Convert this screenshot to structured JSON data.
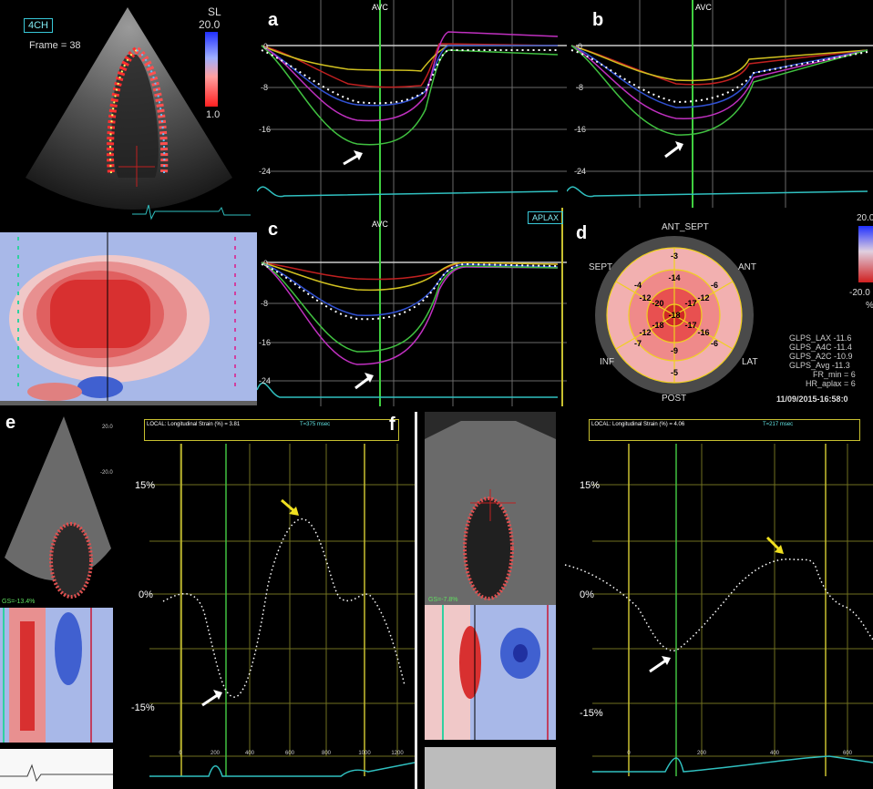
{
  "echo_top": {
    "view_box": "4CH",
    "frame_label": "Frame = 38",
    "scale_label": "SL",
    "scale_top": "20.0",
    "scale_bottom": "1.0"
  },
  "panel_a": {
    "letter": "a",
    "avc": "AVC",
    "ticks": [
      "0",
      "-8",
      "-16",
      "-24"
    ]
  },
  "panel_b": {
    "letter": "b",
    "avc": "AVC",
    "ticks": [
      "0",
      "-8",
      "-16",
      "-24"
    ]
  },
  "panel_c": {
    "letter": "c",
    "avc": "AVC",
    "view_box": "APLAX",
    "ticks": [
      "0",
      "-8",
      "-16",
      "-24"
    ]
  },
  "panel_d": {
    "letter": "d",
    "labels": {
      "ant_sept": "ANT_SEPT",
      "sept": "SEPT",
      "ant": "ANT",
      "inf": "INF",
      "lat": "LAT",
      "post": "POST"
    },
    "segments": [
      "-3",
      "-6",
      "-6",
      "-5",
      "-7",
      "-4",
      "-14",
      "-12",
      "-16",
      "-9",
      "-12",
      "-12",
      "-20",
      "-17",
      "-17",
      "-18",
      "-18"
    ],
    "scale_top": "20.0",
    "scale_bottom": "-20.0",
    "scale_unit": "%",
    "stats": [
      {
        "name": "GLPS_LAX",
        "value": "-11.6"
      },
      {
        "name": "GLPS_A4C",
        "value": "-11.4"
      },
      {
        "name": "GLPS_A2C",
        "value": "-10.9"
      },
      {
        "name": "GLPS_Avg",
        "value": "-11.3"
      },
      {
        "name": "FR_min",
        "value": "6"
      },
      {
        "name": "HR_aplax",
        "value": "6"
      }
    ],
    "date": "11/09/2015-16:58:0"
  },
  "panel_e": {
    "letter": "e",
    "gs": "GS=-13.4%",
    "scale_top": "20.0",
    "scale_bottom": "-20.0"
  },
  "panel_f": {
    "letter": "f",
    "header": "LOCAL: Longitudinal Strain (%) = 3.81",
    "time": "T=375 msec",
    "y_ticks": [
      "15%",
      "0%",
      "-15%"
    ],
    "x_ticks": [
      "0",
      "200",
      "400",
      "600",
      "800",
      "1000",
      "1200"
    ]
  },
  "panel_g": {
    "gs": "GS=-7.8%",
    "header": "LOCAL: Longitudinal Strain (%) = 4.06",
    "time": "T=217 msec",
    "y_ticks": [
      "15%",
      "0%",
      "-15%"
    ],
    "x_ticks": [
      "0",
      "200",
      "400",
      "600"
    ]
  }
}
